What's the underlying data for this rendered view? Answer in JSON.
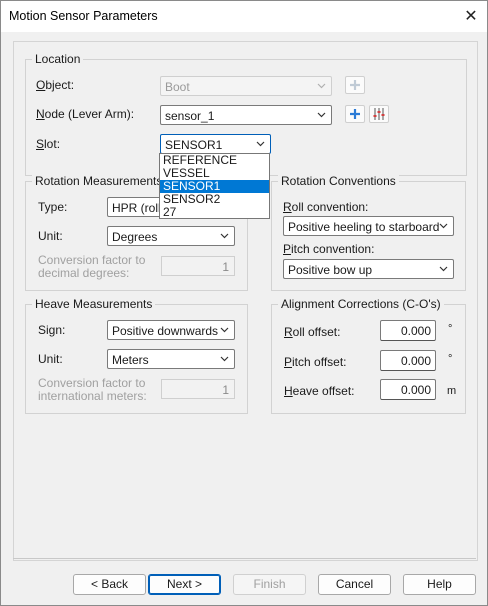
{
  "window": {
    "title": "Motion Sensor Parameters",
    "close_glyph": "✕"
  },
  "location": {
    "group_label": "Location",
    "object_label": "Object:",
    "object_value": "Boot",
    "node_label": "Node (Lever Arm):",
    "node_value": "sensor_1",
    "slot_label": "Slot:",
    "slot_value": "SENSOR1",
    "slot_options": [
      "REFERENCE",
      "VESSEL",
      "SENSOR1",
      "SENSOR2",
      "27"
    ],
    "slot_selected_index": 2
  },
  "rotation_measurements": {
    "group_label": "Rotation Measurements",
    "type_label": "Type:",
    "type_value": "HPR (roll fi",
    "unit_label": "Unit:",
    "unit_value": "Degrees",
    "conversion_label_1": "Conversion factor to",
    "conversion_label_2": "decimal degrees:",
    "conversion_value": "1"
  },
  "rotation_conventions": {
    "group_label": "Rotation Conventions",
    "roll_label": "Roll convention:",
    "roll_value": "Positive heeling to starboard",
    "pitch_label": "Pitch convention:",
    "pitch_value": "Positive bow up"
  },
  "heave_measurements": {
    "group_label": "Heave Measurements",
    "sign_label": "Sign:",
    "sign_value": "Positive downwards",
    "unit_label": "Unit:",
    "unit_value": "Meters",
    "conversion_label_1": "Conversion factor to",
    "conversion_label_2": "international meters:",
    "conversion_value": "1"
  },
  "alignment_corrections": {
    "group_label": "Alignment Corrections (C-O's)",
    "roll_label": "Roll offset:",
    "roll_value": "0.000",
    "roll_unit": "°",
    "pitch_label": "Pitch offset:",
    "pitch_value": "0.000",
    "pitch_unit": "°",
    "heave_label": "Heave offset:",
    "heave_value": "0.000",
    "heave_unit": "m"
  },
  "buttons": {
    "back": "< Back",
    "next": "Next >",
    "finish": "Finish",
    "cancel": "Cancel",
    "help": "Help"
  },
  "colors": {
    "accent": "#005fb8",
    "selection": "#0078d4",
    "window_bg": "#f0f0f0"
  }
}
